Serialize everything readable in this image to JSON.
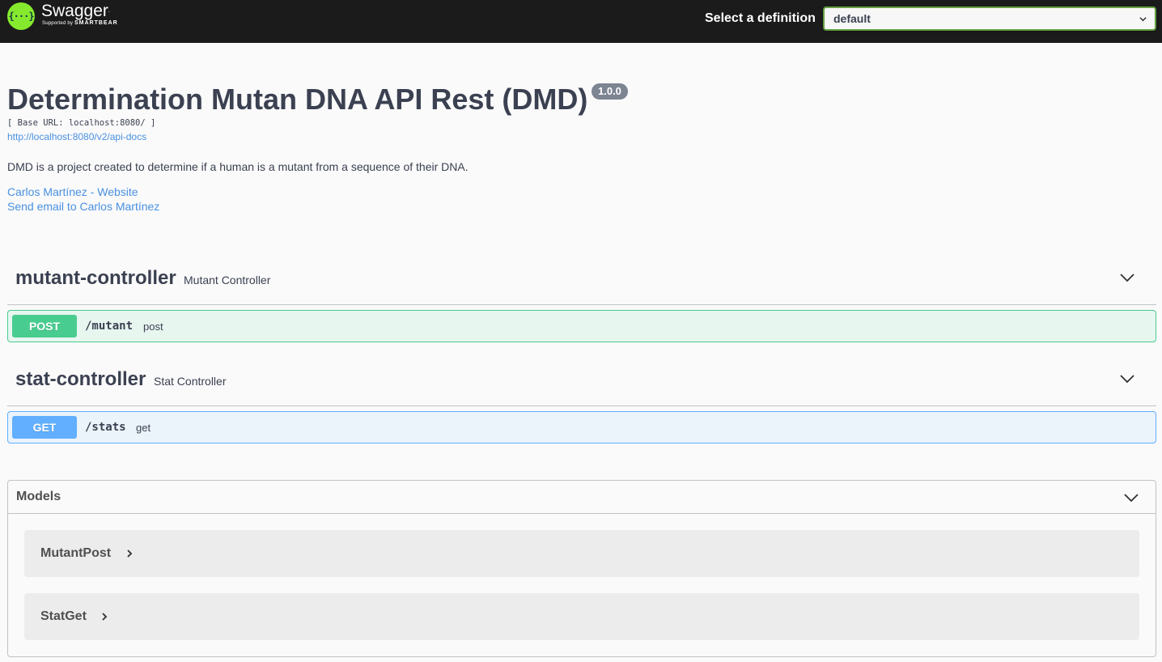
{
  "topbar": {
    "logo_name": "Swagger",
    "logo_tm": ".",
    "logo_supported": "Supported by",
    "logo_company": "SMARTBEAR",
    "definition_label": "Select a definition",
    "definition_selected": "default"
  },
  "info": {
    "title": "Determination Mutan DNA API Rest (DMD)",
    "version": "1.0.0",
    "base_url": "[ Base URL: localhost:8080/ ]",
    "api_docs_link": "http://localhost:8080/v2/api-docs",
    "description": "DMD is a project created to determine if a human is a mutant from a sequence of their DNA.",
    "website_link": "Carlos Martínez - Website",
    "email_link": "Send email to Carlos Martínez"
  },
  "tags": [
    {
      "name": "mutant-controller",
      "description": "Mutant Controller",
      "operation": {
        "method": "POST",
        "path": "/mutant",
        "summary": "post"
      }
    },
    {
      "name": "stat-controller",
      "description": "Stat Controller",
      "operation": {
        "method": "GET",
        "path": "/stats",
        "summary": "get"
      }
    }
  ],
  "models": {
    "title": "Models",
    "items": [
      "MutantPost",
      "StatGet"
    ]
  },
  "colors": {
    "topbar": "#1b1b1b",
    "brand_green": "#85ea2d",
    "post": "#49cc90",
    "get": "#61affe",
    "link": "#4990e2"
  },
  "icons": {
    "logo": "swagger-braces-icon",
    "select": "chevron-down-icon",
    "section_toggle": "chevron-down-icon",
    "model_expand": "chevron-right-icon"
  }
}
